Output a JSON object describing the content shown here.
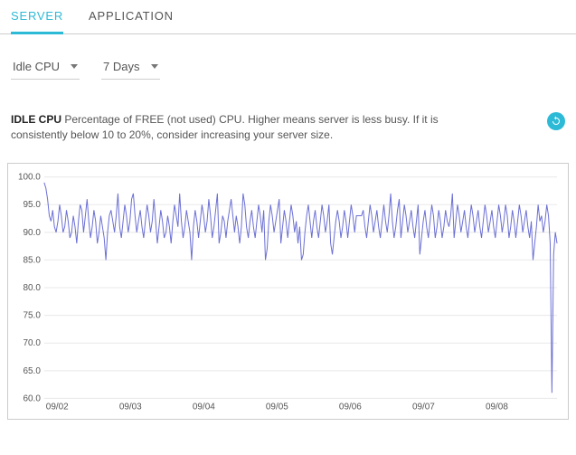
{
  "tabs": {
    "server": "SERVER",
    "application": "APPLICATION",
    "active": "server"
  },
  "controls": {
    "metric": "Idle CPU",
    "range": "7 Days"
  },
  "description": {
    "title": "IDLE CPU",
    "body": "Percentage of FREE (not used) CPU. Higher means server is less busy. If it is consistently below 10 to 20%, consider increasing your server size."
  },
  "icons": {
    "refresh": "refresh"
  },
  "colors": {
    "accent": "#2dbad7",
    "line": "#6b6fd4"
  },
  "chart_data": {
    "type": "line",
    "title": "",
    "xlabel": "",
    "ylabel": "",
    "ylim": [
      60,
      100
    ],
    "yticks": [
      60.0,
      65.0,
      70.0,
      75.0,
      80.0,
      85.0,
      90.0,
      95.0,
      100.0
    ],
    "ytick_labels": [
      "60.0",
      "65.0",
      "70.0",
      "75.0",
      "80.0",
      "85.0",
      "90.0",
      "95.0",
      "100.0"
    ],
    "xtick_labels": [
      "09/02",
      "09/03",
      "09/04",
      "09/05",
      "09/06",
      "09/07",
      "09/08"
    ],
    "x": [
      0,
      1,
      2,
      3,
      4,
      5,
      6,
      7,
      8,
      9,
      10,
      11,
      12,
      13,
      14,
      15,
      16,
      17,
      18,
      19,
      20,
      21,
      22,
      23,
      24,
      25,
      26,
      27,
      28,
      29,
      30,
      31,
      32,
      33,
      34,
      35,
      36,
      37,
      38,
      39,
      40,
      41,
      42,
      43,
      44,
      45,
      46,
      47,
      48,
      49,
      50,
      51,
      52,
      53,
      54,
      55,
      56,
      57,
      58,
      59,
      60,
      61,
      62,
      63,
      64,
      65,
      66,
      67,
      68,
      69,
      70,
      71,
      72,
      73,
      74,
      75,
      76,
      77,
      78,
      79,
      80,
      81,
      82,
      83,
      84,
      85,
      86,
      87,
      88,
      89,
      90,
      91,
      92,
      93,
      94,
      95,
      96,
      97,
      98,
      99,
      100,
      101,
      102,
      103,
      104,
      105,
      106,
      107,
      108,
      109,
      110,
      111,
      112,
      113,
      114,
      115,
      116,
      117,
      118,
      119,
      120,
      121,
      122,
      123,
      124,
      125,
      126,
      127,
      128,
      129,
      130,
      131,
      132,
      133,
      134,
      135,
      136,
      137,
      138,
      139,
      140,
      141,
      142,
      143,
      144,
      145,
      146,
      147,
      148,
      149,
      150,
      151,
      152,
      153,
      154,
      155,
      156,
      157,
      158,
      159,
      160,
      161,
      162,
      163,
      164,
      165,
      166,
      167,
      168,
      169,
      170,
      171,
      172,
      173,
      174,
      175,
      176,
      177,
      178,
      179,
      180,
      181,
      182,
      183,
      184,
      185,
      186,
      187,
      188,
      189,
      190,
      191,
      192,
      193,
      194,
      195,
      196,
      197,
      198,
      199,
      200,
      201,
      202,
      203,
      204,
      205,
      206,
      207,
      208,
      209,
      210,
      211,
      212,
      213,
      214,
      215,
      216,
      217,
      218,
      219,
      220,
      221,
      222,
      223,
      224,
      225,
      226,
      227,
      228,
      229,
      230,
      231,
      232,
      233,
      234,
      235,
      236,
      237,
      238,
      239,
      240,
      241,
      242,
      243,
      244,
      245,
      246,
      247,
      248,
      249,
      250,
      251,
      252,
      253,
      254,
      255,
      256,
      257,
      258,
      259,
      260,
      261,
      262,
      263,
      264,
      265,
      266,
      267,
      268,
      269,
      270,
      271,
      272,
      273,
      274,
      275,
      276,
      277,
      278,
      279,
      280,
      281,
      282,
      283,
      284,
      285,
      286,
      287,
      288,
      289,
      290,
      291,
      292,
      293,
      294,
      295,
      296,
      297,
      298,
      299
    ],
    "values": [
      99,
      98,
      96,
      93,
      92,
      94,
      91,
      90,
      92,
      95,
      93,
      90,
      91,
      94,
      92,
      89,
      90,
      93,
      91,
      88,
      92,
      95,
      94,
      90,
      93,
      96,
      92,
      89,
      91,
      94,
      92,
      88,
      90,
      93,
      91,
      89,
      85,
      90,
      93,
      94,
      92,
      90,
      93,
      97,
      91,
      89,
      92,
      95,
      93,
      90,
      92,
      96,
      97,
      93,
      90,
      92,
      94,
      91,
      89,
      92,
      95,
      93,
      90,
      92,
      96,
      92,
      88,
      91,
      94,
      92,
      89,
      90,
      93,
      91,
      88,
      92,
      95,
      93,
      91,
      97,
      92,
      89,
      91,
      94,
      92,
      90,
      85,
      91,
      94,
      92,
      89,
      92,
      95,
      93,
      90,
      92,
      96,
      93,
      89,
      91,
      94,
      97,
      88,
      90,
      93,
      92,
      89,
      92,
      94,
      96,
      93,
      90,
      93,
      91,
      88,
      91,
      97,
      95,
      91,
      89,
      92,
      94,
      91,
      89,
      92,
      95,
      93,
      90,
      94,
      85,
      87,
      92,
      95,
      93,
      90,
      92,
      94,
      96,
      88,
      91,
      94,
      92,
      89,
      92,
      95,
      93,
      90,
      92,
      88,
      91,
      85,
      86,
      90,
      93,
      95,
      92,
      89,
      92,
      94,
      91,
      89,
      92,
      95,
      93,
      90,
      92,
      95,
      88,
      86,
      89,
      92,
      94,
      92,
      89,
      91,
      94,
      92,
      89,
      92,
      95,
      93,
      90,
      93,
      93,
      93,
      93,
      94,
      91,
      89,
      92,
      95,
      93,
      90,
      92,
      94,
      91,
      89,
      92,
      95,
      92,
      90,
      93,
      97,
      92,
      89,
      91,
      94,
      96,
      89,
      92,
      95,
      93,
      90,
      92,
      94,
      91,
      89,
      92,
      95,
      86,
      89,
      92,
      94,
      91,
      89,
      92,
      95,
      93,
      89,
      91,
      94,
      92,
      89,
      91,
      94,
      92,
      91,
      93,
      97,
      89,
      92,
      95,
      93,
      90,
      92,
      94,
      91,
      89,
      92,
      95,
      93,
      90,
      92,
      94,
      91,
      89,
      92,
      95,
      93,
      90,
      92,
      94,
      91,
      89,
      92,
      95,
      93,
      90,
      92,
      95,
      93,
      89,
      91,
      94,
      92,
      89,
      92,
      95,
      93,
      90,
      92,
      94,
      91,
      89,
      92,
      85,
      88,
      91,
      95,
      92,
      93,
      90,
      92,
      95,
      93,
      88,
      61,
      86,
      90,
      88
    ]
  }
}
